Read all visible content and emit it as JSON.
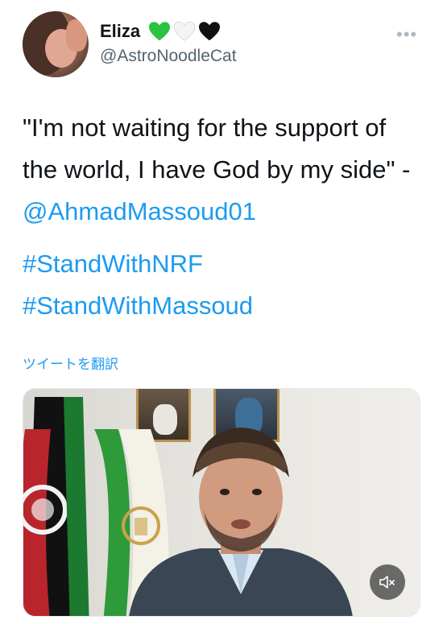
{
  "author": {
    "display_name": "Eliza",
    "handle": "@AstroNoodleCat",
    "emoji_hearts": [
      "green-heart-icon",
      "white-heart-icon",
      "black-heart-icon"
    ]
  },
  "tweet": {
    "text_before_mention": "\"I'm not waiting for the support of the world, I have God by my side\" - ",
    "mention": "@AhmadMassoud01",
    "hashtags": [
      "#StandWithNRF",
      "#StandWithMassoud"
    ],
    "translate_label": "ツイートを翻訳"
  },
  "media": {
    "type": "video",
    "mute_icon": "speaker-muted-icon"
  },
  "colors": {
    "link": "#1d9bf0",
    "text": "#0f1419",
    "secondary": "#536471",
    "green_heart": "#2bc33f",
    "black_heart": "#111111"
  }
}
